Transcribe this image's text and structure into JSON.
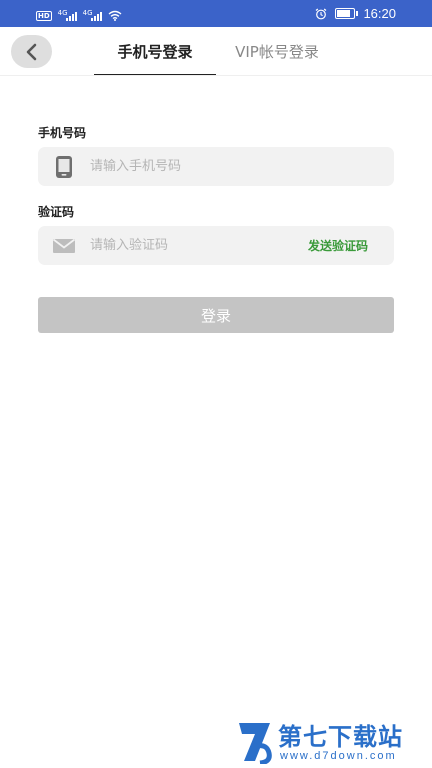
{
  "status_bar": {
    "hd_badge": "HD",
    "network_1": "4G",
    "network_2": "4G",
    "time": "16:20",
    "battery_level": 0.8,
    "icons": [
      "hd-badge",
      "signal-icon",
      "signal-icon",
      "wifi-icon",
      "alarm-icon",
      "battery-icon"
    ]
  },
  "header": {
    "back_icon": "chevron-left-icon",
    "tabs": [
      {
        "label": "手机号登录",
        "active": true
      },
      {
        "label": "VIP帐号登录",
        "active": false
      }
    ]
  },
  "form": {
    "phone": {
      "label": "手机号码",
      "placeholder": "请输入手机号码",
      "value": "",
      "icon": "phone-icon"
    },
    "code": {
      "label": "验证码",
      "placeholder": "请输入验证码",
      "value": "",
      "icon": "mail-icon",
      "send_label": "发送验证码"
    },
    "login_label": "登录"
  },
  "watermark": {
    "title": "第七下载站",
    "url": "www.d7down.com"
  },
  "colors": {
    "status_bar": "#3b63c9",
    "accent_green": "#3a9a3a",
    "login_disabled": "#c4c4c4",
    "field_bg": "#f2f2f2",
    "watermark_blue": "#2a6fc9"
  }
}
